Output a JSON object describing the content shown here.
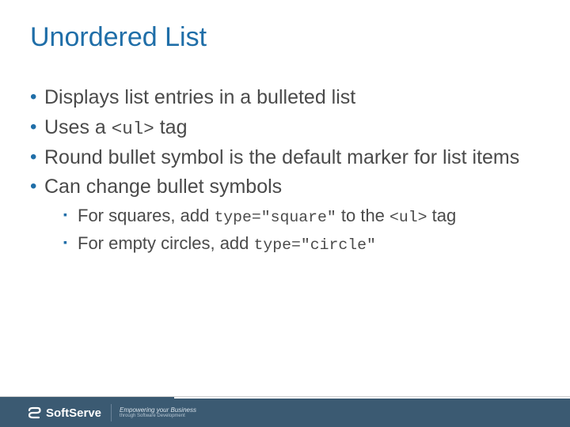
{
  "title": "Unordered List",
  "bullets": [
    {
      "text": "Displays list entries in a bulleted list"
    },
    {
      "pre": "Uses a ",
      "code": "<ul>",
      "post": " tag"
    },
    {
      "text": "Round bullet symbol is the default marker for list items"
    },
    {
      "text": "Can change bullet symbols"
    }
  ],
  "sub": [
    {
      "pre": "For squares, add ",
      "code": "type=\"square\"",
      "mid": " to the ",
      "code2": "<ul>",
      "post": " tag"
    },
    {
      "pre": "For empty circles, add ",
      "code": "type=\"circle\""
    }
  ],
  "footer": {
    "brand": "SoftServe",
    "tagline_top": "Empowering your Business",
    "tagline_bottom": "through Software Development"
  }
}
